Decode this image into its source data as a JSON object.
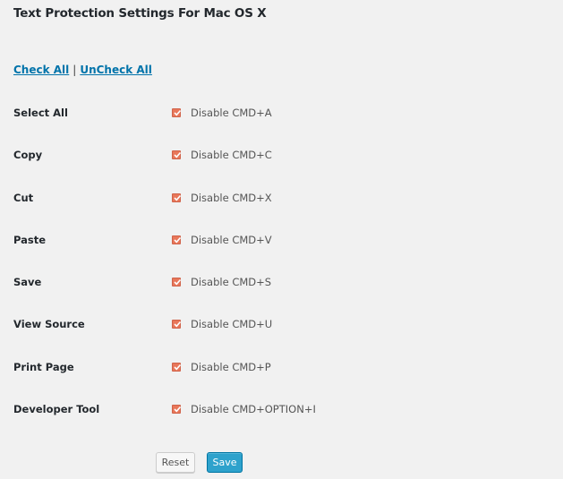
{
  "page": {
    "title": "Text Protection Settings For Mac OS X"
  },
  "bulk_links": {
    "check_all": "Check All",
    "separator": "|",
    "uncheck_all": "UnCheck All"
  },
  "settings": [
    {
      "label": "Select All",
      "option": "Disable CMD+A",
      "checked": true
    },
    {
      "label": "Copy",
      "option": "Disable CMD+C",
      "checked": true
    },
    {
      "label": "Cut",
      "option": "Disable CMD+X",
      "checked": true
    },
    {
      "label": "Paste",
      "option": "Disable CMD+V",
      "checked": true
    },
    {
      "label": "Save",
      "option": "Disable CMD+S",
      "checked": true
    },
    {
      "label": "View Source",
      "option": "Disable CMD+U",
      "checked": true
    },
    {
      "label": "Print Page",
      "option": "Disable CMD+P",
      "checked": true
    },
    {
      "label": "Developer Tool",
      "option": "Disable CMD+OPTION+I",
      "checked": true
    }
  ],
  "actions": {
    "reset_label": "Reset",
    "save_label": "Save"
  },
  "colors": {
    "checkbox_fill": "#e8775a",
    "link": "#0073aa",
    "primary_button": "#2ea2cc"
  }
}
